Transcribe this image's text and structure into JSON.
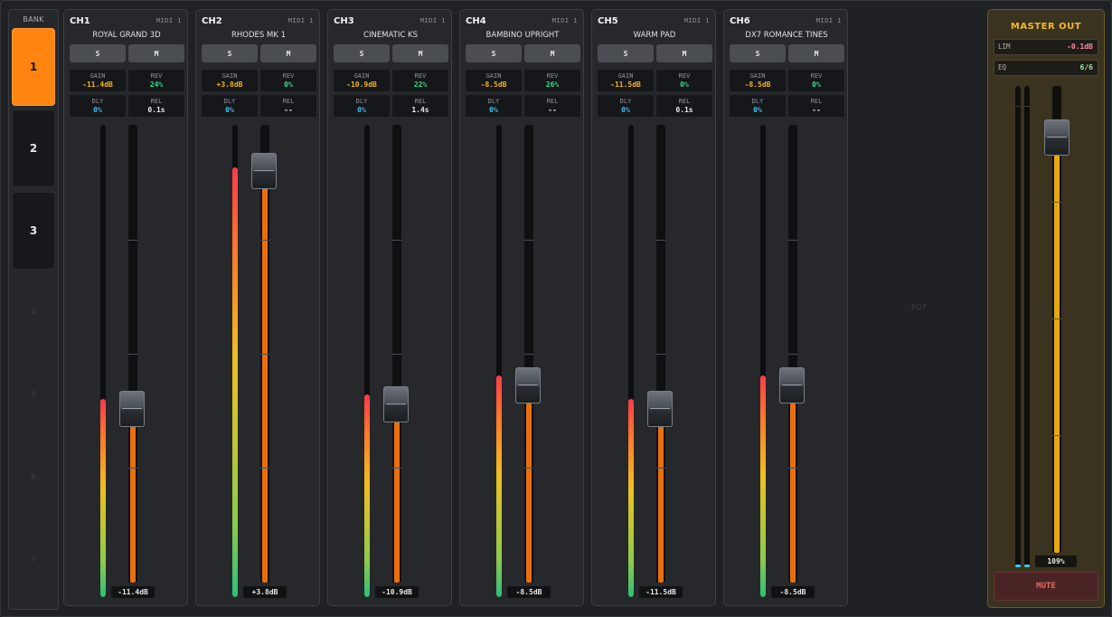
{
  "bank": {
    "title": "BANK",
    "buttons": [
      {
        "label": "1",
        "active": true
      },
      {
        "label": "2",
        "active": false
      },
      {
        "label": "3",
        "active": false
      }
    ],
    "ghost_labels": [
      "4",
      "5",
      "6",
      "7"
    ]
  },
  "eq_ghost_label": "EQ7",
  "colors": {
    "accent": "#ff8412",
    "gain": "#f2b31a",
    "rev": "#2ee08a",
    "dly": "#35c3ff",
    "rel": "#e8eaec",
    "master_title": "#f2b82a",
    "lim": "#ff8a9a",
    "eq": "#9be89b",
    "mute": "#e86a6a"
  },
  "labels": {
    "solo": "S",
    "mute": "M",
    "gain": "GAIN",
    "rev": "REV",
    "dly": "DLY",
    "rel": "REL"
  },
  "channels": [
    {
      "id": "CH1",
      "midi": "MIDI 1",
      "name": "ROYAL GRAND 3D",
      "gain": "-11.4dB",
      "rev": "24%",
      "dly": "0%",
      "rel": "0.1s",
      "db": "-11.4dB",
      "meter_level": 0.42,
      "fader_level": 0.38
    },
    {
      "id": "CH2",
      "midi": "MIDI 1",
      "name": "RHODES MK 1",
      "gain": "+3.8dB",
      "rev": "0%",
      "dly": "0%",
      "rel": "--",
      "db": "+3.8dB",
      "meter_level": 0.91,
      "fader_level": 0.9
    },
    {
      "id": "CH3",
      "midi": "MIDI 1",
      "name": "CINEMATIC KS",
      "gain": "-10.9dB",
      "rev": "22%",
      "dly": "0%",
      "rel": "1.4s",
      "db": "-10.9dB",
      "meter_level": 0.43,
      "fader_level": 0.39
    },
    {
      "id": "CH4",
      "midi": "MIDI 1",
      "name": "BAMBINO UPRIGHT",
      "gain": "-8.5dB",
      "rev": "26%",
      "dly": "0%",
      "rel": "--",
      "db": "-8.5dB",
      "meter_level": 0.47,
      "fader_level": 0.43
    },
    {
      "id": "CH5",
      "midi": "MIDI 1",
      "name": "WARM PAD",
      "gain": "-11.5dB",
      "rev": "0%",
      "dly": "0%",
      "rel": "0.1s",
      "db": "-11.5dB",
      "meter_level": 0.42,
      "fader_level": 0.38
    },
    {
      "id": "CH6",
      "midi": "MIDI 1",
      "name": "DX7 ROMANCE TINES",
      "gain": "-8.5dB",
      "rev": "0%",
      "dly": "0%",
      "rel": "--",
      "db": "-8.5dB",
      "meter_level": 0.47,
      "fader_level": 0.43
    }
  ],
  "master": {
    "title": "MASTER OUT",
    "lim_label": "LIM",
    "lim_value": "-0.1dB",
    "eq_label": "EQ",
    "eq_value": "6/6",
    "level": "109%",
    "fader_level": 0.89,
    "mute_label": "MUTE"
  }
}
